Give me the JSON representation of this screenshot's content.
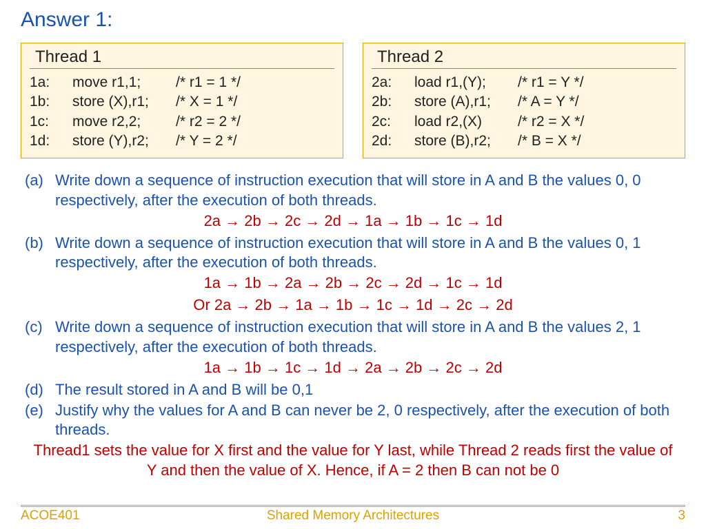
{
  "title": "Answer 1:",
  "thread1": {
    "title": "Thread 1",
    "rows": [
      {
        "label": "1a:",
        "instr": "move r1,1;",
        "comment": "/* r1 = 1 */"
      },
      {
        "label": "1b:",
        "instr": "store (X),r1;",
        "comment": "/* X = 1 */"
      },
      {
        "label": "1c:",
        "instr": "move r2,2;",
        "comment": "/* r2 = 2 */"
      },
      {
        "label": "1d:",
        "instr": "store (Y),r2;",
        "comment": "/* Y = 2 */"
      }
    ]
  },
  "thread2": {
    "title": "Thread 2",
    "rows": [
      {
        "label": "2a:",
        "instr": "load r1,(Y);",
        "comment": "/* r1 = Y */"
      },
      {
        "label": "2b:",
        "instr": "store (A),r1;",
        "comment": "/* A = Y */"
      },
      {
        "label": "2c:",
        "instr": "load r2,(X)",
        "comment": "/* r2 = X */"
      },
      {
        "label": "2d:",
        "instr": "store (B),r2;",
        "comment": "/* B = X */"
      }
    ]
  },
  "qa": {
    "a_label": "(a)",
    "a_text": "Write down a sequence of instruction execution that will store in A and B the values 0, 0 respectively, after the execution of both threads.",
    "a_ans": "2a → 2b → 2c → 2d → 1a → 1b → 1c → 1d",
    "b_label": "(b)",
    "b_text": "Write down a sequence of instruction execution that will store in A and B the values 0, 1 respectively, after the execution of both threads.",
    "b_ans1": "1a → 1b → 2a → 2b → 2c → 2d → 1c → 1d",
    "b_ans2": "Or 2a → 2b → 1a → 1b → 1c → 1d → 2c → 2d",
    "c_label": "(c)",
    "c_text": "Write down a sequence of instruction execution that will store in A and B the values 2, 1 respectively, after the execution of both threads.",
    "c_ans": "1a → 1b → 1c → 1d → 2a → 2b → 2c → 2d",
    "d_label": "(d)",
    "d_text": "The result stored in A and B will be 0,1",
    "e_label": "(e)",
    "e_text": "Justify why the values for A and B can never be 2, 0 respectively, after the execution of both threads.",
    "e_ans": "Thread1 sets the value for X first and the value for Y last, while Thread 2 reads first the value of Y and then the value of X. Hence, if A = 2 then B can not be 0"
  },
  "footer": {
    "left": "ACOE401",
    "center": "Shared Memory Architectures",
    "right": "3"
  }
}
